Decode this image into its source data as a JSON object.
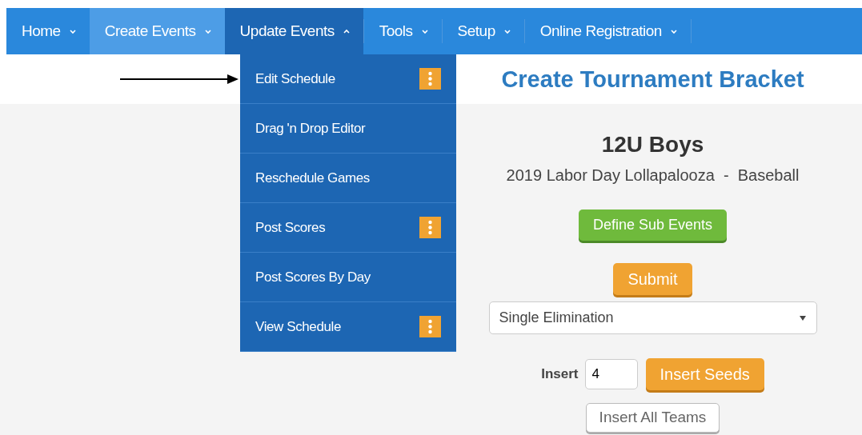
{
  "nav": [
    {
      "label": "Home",
      "hovered": false,
      "expanded": false
    },
    {
      "label": "Create Events",
      "hovered": true,
      "expanded": false
    },
    {
      "label": "Update Events",
      "hovered": false,
      "expanded": true
    },
    {
      "label": "Tools",
      "hovered": false,
      "expanded": false
    },
    {
      "label": "Setup",
      "hovered": false,
      "expanded": false
    },
    {
      "label": "Online Registration",
      "hovered": false,
      "expanded": false
    }
  ],
  "dropdown": [
    {
      "label": "Edit Schedule",
      "has_options": true
    },
    {
      "label": "Drag 'n Drop Editor",
      "has_options": false
    },
    {
      "label": "Reschedule Games",
      "has_options": false
    },
    {
      "label": "Post Scores",
      "has_options": true
    },
    {
      "label": "Post Scores By Day",
      "has_options": false
    },
    {
      "label": "View Schedule",
      "has_options": true
    }
  ],
  "page_title": "Create Tournament Bracket",
  "division": "12U Boys",
  "event": "2019 Labor Day Lollapalooza  -  Baseball",
  "define_button": "Define Sub Events",
  "submit_button": "Submit",
  "bracket_type": {
    "value": "Single Elimination"
  },
  "insert_label": "Insert",
  "insert_field": {
    "value": "4"
  },
  "insert_seeds_button": "Insert Seeds",
  "insert_all_button": "Insert All Teams"
}
